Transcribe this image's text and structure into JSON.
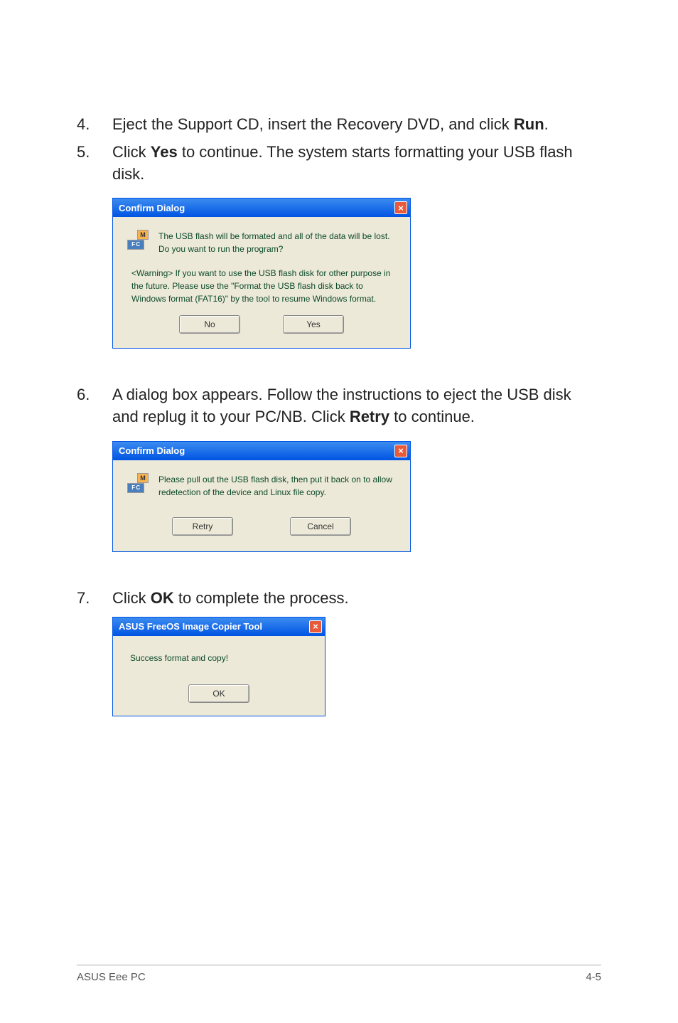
{
  "steps": {
    "s4": {
      "num": "4.",
      "a": "Eject the Support CD, insert the Recovery DVD, and click ",
      "b": "Run",
      "c": "."
    },
    "s5": {
      "num": "5.",
      "a": "Click ",
      "b": "Yes",
      "c": " to continue. The system starts formatting your USB flash disk."
    },
    "s6": {
      "num": "6.",
      "a": "A dialog box appears. Follow the instructions to eject the USB disk and replug it to your PC/NB. Click ",
      "b": "Retry",
      "c": " to continue."
    },
    "s7": {
      "num": "7.",
      "a": "Click ",
      "b": "OK",
      "c": " to complete the process."
    }
  },
  "dialog1": {
    "title": "Confirm Dialog",
    "msg": "The USB flash will be formated and all of the data will be lost. Do you want to run the program?",
    "warn": "<Warning> If you want to use the USB flash disk for other purpose in the future. Please use the \"Format the USB flash disk back to Windows format (FAT16)\" by the tool to resume Windows format.",
    "btn_no": "No",
    "btn_yes": "Yes",
    "close": "×"
  },
  "dialog2": {
    "title": "Confirm Dialog",
    "msg": "Please pull out the USB flash disk, then put it back on to allow redetection of the device and Linux file copy.",
    "btn_retry": "Retry",
    "btn_cancel": "Cancel",
    "close": "×"
  },
  "dialog3": {
    "title": "ASUS FreeOS Image Copier Tool",
    "msg": "Success format and copy!",
    "btn_ok": "OK",
    "close": "×"
  },
  "icon": {
    "m": "M",
    "fc": "F C"
  },
  "footer": {
    "left": "ASUS Eee PC",
    "right": "4-5"
  }
}
